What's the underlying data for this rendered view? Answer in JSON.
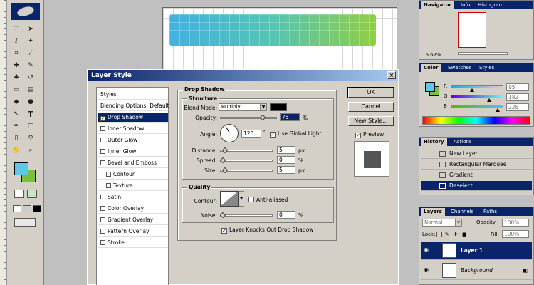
{
  "colors": {
    "accent": "#0a246a",
    "bar_left": "#3aaee0",
    "bar_right": "#8ccc3a",
    "foreground": "#5ec8e8",
    "background": "#7cc040"
  },
  "toolbox": {
    "icons": [
      "marquee-icon",
      "move-icon",
      "lasso-icon",
      "magic-wand-icon",
      "crop-icon",
      "slice-icon",
      "healing-icon",
      "brush-icon",
      "stamp-icon",
      "history-brush-icon",
      "eraser-icon",
      "gradient-icon",
      "blur-icon",
      "dodge-icon",
      "path-select-icon",
      "type-icon",
      "pen-icon",
      "shape-icon",
      "notes-icon",
      "eyedropper-icon",
      "hand-icon",
      "zoom-icon"
    ],
    "type_glyph": "T"
  },
  "dialog": {
    "title": "Layer Style",
    "close_glyph": "×",
    "styles_list": [
      {
        "label": "Styles",
        "check": false
      },
      {
        "label": "Blending Options: Default",
        "check": false
      },
      {
        "label": "Drop Shadow",
        "check": true,
        "selected": true
      },
      {
        "label": "Inner Shadow",
        "check": true
      },
      {
        "label": "Outer Glow",
        "check": true
      },
      {
        "label": "Inner Glow",
        "check": true
      },
      {
        "label": "Bevel and Emboss",
        "check": true
      },
      {
        "label": "Contour",
        "check": true,
        "indent": true
      },
      {
        "label": "Texture",
        "check": true,
        "indent": true
      },
      {
        "label": "Satin",
        "check": true
      },
      {
        "label": "Color Overlay",
        "check": true
      },
      {
        "label": "Gradient Overlay",
        "check": true
      },
      {
        "label": "Pattern Overlay",
        "check": true
      },
      {
        "label": "Stroke",
        "check": true
      }
    ],
    "drop_shadow": {
      "section_title": "Drop Shadow",
      "structure_title": "Structure",
      "blend_mode_label": "Blend Mode:",
      "blend_mode_value": "Multiply",
      "opacity_label": "Opacity:",
      "opacity_value": "75",
      "opacity_fraction": 0.75,
      "angle_label": "Angle:",
      "angle_value": "120",
      "degree_sign": "°",
      "use_global_light": "Use Global Light",
      "distance_label": "Distance:",
      "distance_value": "5",
      "distance_fraction": 0.05,
      "spread_label": "Spread:",
      "spread_value": "0",
      "spread_fraction": 0.0,
      "size_label": "Size:",
      "size_value": "5",
      "size_fraction": 0.05,
      "unit_percent": "%",
      "unit_px": "px",
      "quality_title": "Quality",
      "contour_label": "Contour:",
      "anti_aliased": "Anti-aliased",
      "noise_label": "Noise:",
      "noise_value": "0",
      "noise_fraction": 0.0,
      "knocks_out": "Layer Knocks Out Drop Shadow"
    },
    "buttons": {
      "ok": "OK",
      "cancel": "Cancel",
      "new_style": "New Style...",
      "preview": "Preview"
    }
  },
  "navigator": {
    "tabs": [
      "Navigator",
      "Info",
      "Histogram"
    ],
    "zoom": "16.67%"
  },
  "color_panel": {
    "tabs": [
      "Color",
      "Swatches",
      "Styles"
    ],
    "channels": [
      {
        "label": "R",
        "value": "95",
        "fraction": 0.37
      },
      {
        "label": "G",
        "value": "182",
        "fraction": 0.71
      },
      {
        "label": "B",
        "value": "228",
        "fraction": 0.89
      }
    ]
  },
  "history_panel": {
    "tabs": [
      "History",
      "Actions"
    ],
    "items": [
      {
        "label": "New Layer",
        "selected": false
      },
      {
        "label": "Rectangular Marquee",
        "selected": false
      },
      {
        "label": "Gradient",
        "selected": false
      },
      {
        "label": "Deselect",
        "selected": true
      }
    ]
  },
  "layers_panel": {
    "tabs": [
      "Layers",
      "Channels",
      "Paths"
    ],
    "blend_mode": "Normal",
    "opacity_label": "Opacity:",
    "opacity_value": "100%",
    "lock_label": "Lock:",
    "fill_label": "Fill:",
    "fill_value": "100%",
    "layers": [
      {
        "name": "Layer 1",
        "selected": true
      },
      {
        "name": "Background",
        "selected": false
      }
    ]
  }
}
